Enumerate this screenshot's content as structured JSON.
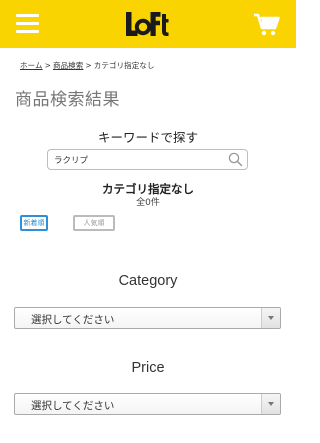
{
  "header": {
    "logo_text": "LoFt",
    "accent_color": "#f9d400",
    "menu_icon": "hamburger-menu-icon",
    "cart_icon": "shopping-cart-icon"
  },
  "breadcrumb": {
    "home": "ホーム",
    "sep": ">",
    "search": "商品検索",
    "current": "カテゴリ指定なし"
  },
  "page_title": "商品検索結果",
  "keyword": {
    "label": "キーワードで探す",
    "value": "ラクリプ"
  },
  "results": {
    "category_label": "カテゴリ指定なし",
    "count": "全0件"
  },
  "sort": {
    "newest": "新着順",
    "popular": "人気順"
  },
  "category": {
    "title": "Category",
    "selected": "選択してください"
  },
  "price": {
    "title": "Price",
    "selected": "選択してください"
  }
}
